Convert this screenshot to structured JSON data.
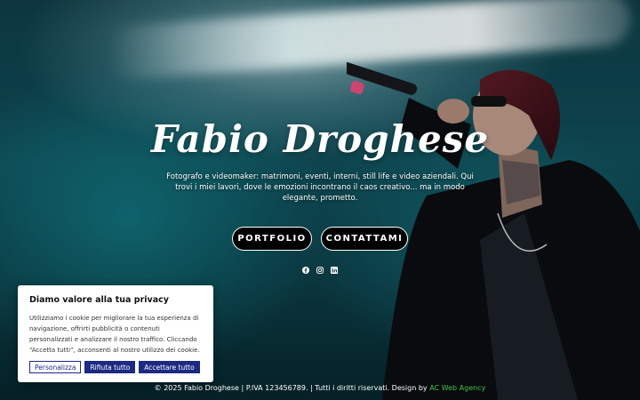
{
  "hero": {
    "title": "Fabio Droghese",
    "subtitle": "Fotografo e videomaker: matrimoni, eventi, interni, still life e video aziendali. Qui trovi i miei lavori, dove le emozioni incontrano il caos creativo... ma in modo elegante, prometto.",
    "buttons": {
      "portfolio": "PORTFOLIO",
      "contact": "CONTATTAMI"
    },
    "social_icons": [
      "facebook-icon",
      "instagram-icon",
      "linkedin-icon"
    ]
  },
  "cookie_banner": {
    "title": "Diamo valore alla tua privacy",
    "text": "Utilizziamo i cookie per migliorare la tua esperienza di navigazione, offrirti pubblicità o contenuti personalizzati e analizzare il nostro traffico. Cliccando “Accetta tutti”, acconsenti al nostro utilizzo dei cookie.",
    "customize_label": "Personalizza",
    "reject_label": "Rifiuta tutto",
    "accept_label": "Accettare tutto"
  },
  "footer": {
    "text": "© 2025 Fabio Droghese | P.IVA 123456789. | Tutti i diritti riservati. Design by ",
    "agency": "AC Web Agency"
  },
  "colors": {
    "accent": "#1c2a83",
    "footer_link": "#45c34a"
  }
}
